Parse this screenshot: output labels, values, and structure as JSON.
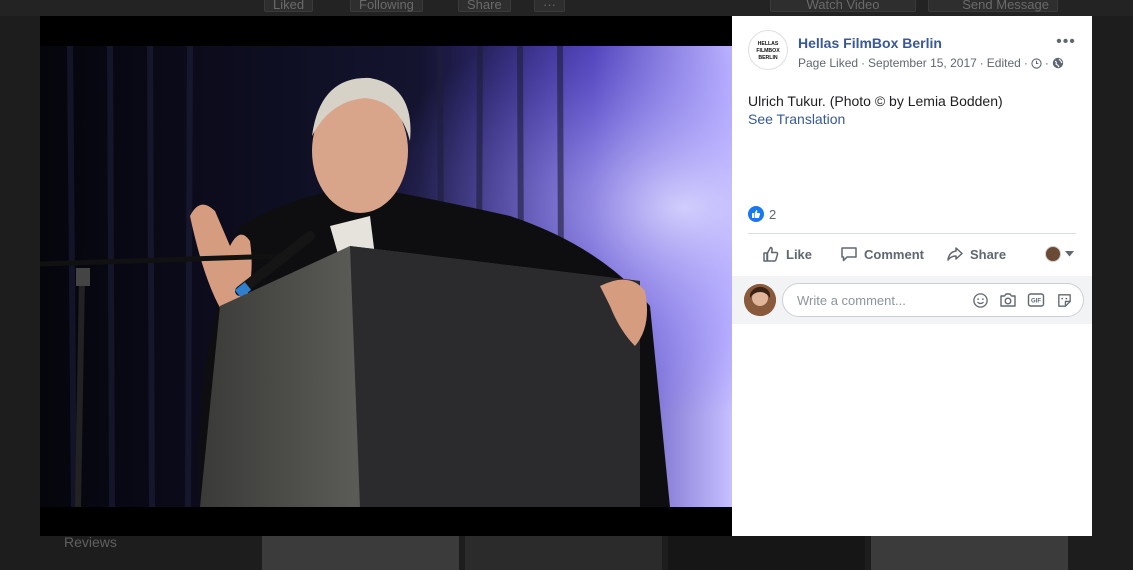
{
  "background": {
    "buttons": [
      "Liked",
      "Following",
      "Share",
      "···",
      "Watch Video",
      "Send Message"
    ],
    "reviews_label": "Reviews"
  },
  "post": {
    "page_name": "Hellas FilmBox Berlin",
    "logo_text": [
      "HELLAS",
      "FILMBOX",
      "BERLIN"
    ],
    "meta_liked": "Page Liked",
    "meta_date": "September 15, 2017",
    "meta_edited": "Edited",
    "separator": "·",
    "caption": "Ulrich Tukur. (Photo © by Lemia Bodden)",
    "see_translation": "See Translation",
    "reaction_count": "2"
  },
  "actions": {
    "like": "Like",
    "comment": "Comment",
    "share": "Share"
  },
  "comment": {
    "placeholder": "Write a comment..."
  },
  "icons": {
    "more": "more-options-icon",
    "privacy": "globe-icon",
    "clock": "clock-icon",
    "emoji": "emoji-icon",
    "camera": "camera-icon",
    "gif": "gif-icon",
    "sticker": "sticker-icon"
  },
  "colors": {
    "link_blue": "#385898",
    "like_blue": "#1877f2",
    "text_gray": "#606770"
  }
}
